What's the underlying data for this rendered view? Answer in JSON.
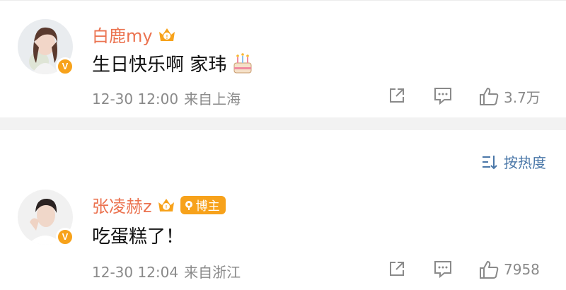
{
  "comments": [
    {
      "username": "白鹿my",
      "text": "生日快乐啊 家玮",
      "emoji_name": "cake-emoji",
      "time": "12-30 12:00",
      "location": "来自上海",
      "likes": "3.7万",
      "has_blogger_tag": false
    },
    {
      "username": "张凌赫z",
      "text": "吃蛋糕了！",
      "time": "12-30 12:04",
      "location": "来自浙江",
      "likes": "7958",
      "blogger_tag": "博主"
    }
  ],
  "sort_label": "按热度",
  "colors": {
    "name": "#eb7350",
    "badge": "#f7a21b",
    "link": "#4a77a8",
    "meta": "#8a8a8a"
  }
}
